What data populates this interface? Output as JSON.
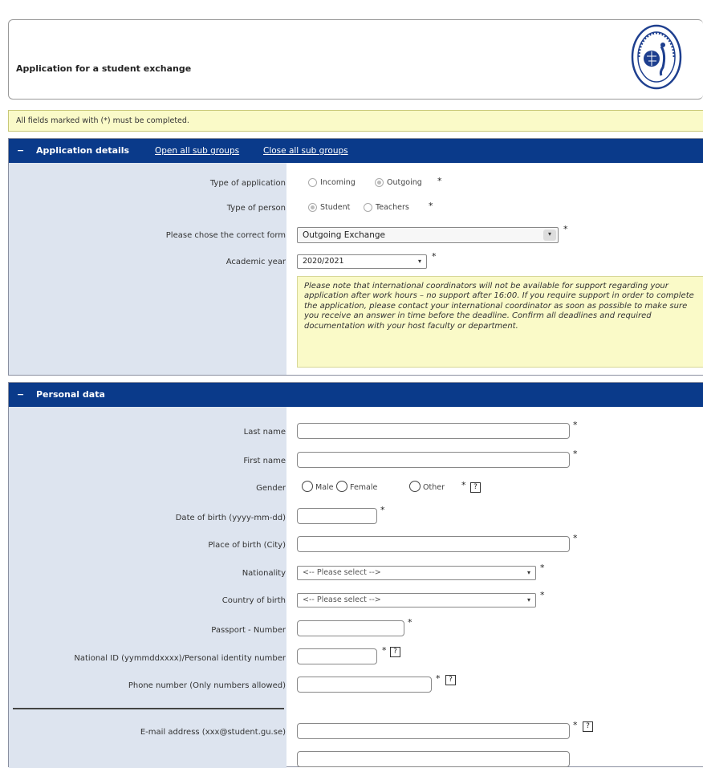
{
  "header": {
    "title": "Application for a student exchange",
    "logo": "university-seal"
  },
  "notice": "All fields marked with (*) must be completed.",
  "app_section": {
    "toggle": "−",
    "title": "Application details",
    "open_all": "Open all sub groups",
    "close_all": "Close all sub groups",
    "type_of_application": {
      "label": "Type of application",
      "options": [
        "Incoming",
        "Outgoing"
      ],
      "selected": "Outgoing"
    },
    "type_of_person": {
      "label": "Type of person",
      "options": [
        "Student",
        "Teachers"
      ],
      "selected": "Student"
    },
    "form": {
      "label": "Please chose the correct form",
      "value": "Outgoing Exchange"
    },
    "academic_year": {
      "label": "Academic year",
      "value": "2020/2021"
    },
    "info": "Please note that international coordinators will not be available for support regarding your application after work hours – no support after 16:00. If you require support in order to complete the application, please contact your international coordinator as soon as possible to make sure you receive an answer in time before the deadline. Confirm all deadlines and required documentation with your host faculty or department."
  },
  "personal_section": {
    "toggle": "−",
    "title": "Personal data",
    "last_name": "Last name",
    "first_name": "First name",
    "gender": {
      "label": "Gender",
      "options": [
        "Male",
        "Female",
        "Other"
      ]
    },
    "dob": "Date of birth (yyyy-mm-dd)",
    "pob": "Place of birth (City)",
    "nationality": {
      "label": "Nationality",
      "placeholder": "<-- Please select -->"
    },
    "country_of_birth": {
      "label": "Country of birth",
      "placeholder": "<-- Please select -->"
    },
    "passport": "Passport - Number",
    "national_id": "National ID (yymmddxxxx)/Personal identity number",
    "phone": "Phone number (Only numbers allowed)",
    "email": "E-mail address (xxx@student.gu.se)"
  },
  "required_mark": "*",
  "help_mark": "?",
  "colors": {
    "section_header": "#0a3a8a",
    "label_bg": "#dde4ef",
    "notice_bg": "#fafac8"
  }
}
